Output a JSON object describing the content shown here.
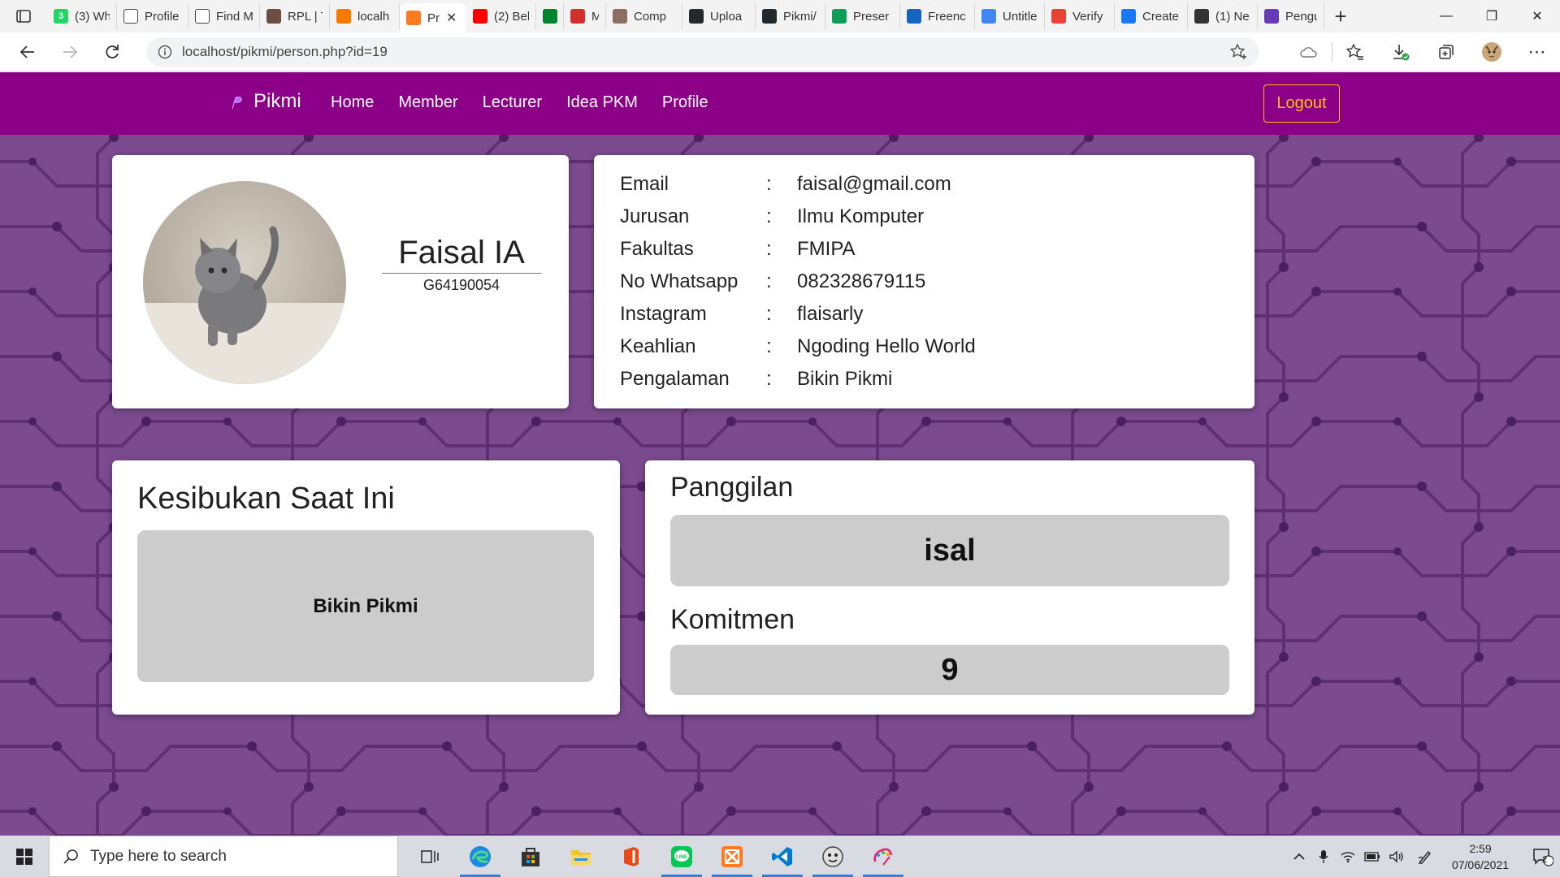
{
  "browser": {
    "tabs": [
      {
        "label": "(3) Wh",
        "icon": "whatsapp-icon",
        "color": "#25d366",
        "badge": "3"
      },
      {
        "label": "Profile",
        "icon": "page-icon",
        "color": "#ffffff"
      },
      {
        "label": "Find M",
        "icon": "page-icon",
        "color": "#ffffff"
      },
      {
        "label": "RPL | T",
        "icon": "book-icon",
        "color": "#6d4c41"
      },
      {
        "label": "localh",
        "icon": "phpmyadmin-icon",
        "color": "#f57c00"
      },
      {
        "label": "Pr",
        "icon": "xampp-icon",
        "color": "#fb7a24",
        "active": true
      },
      {
        "label": "(2) Bel",
        "icon": "youtube-icon",
        "color": "#ff0000"
      },
      {
        "label": "",
        "icon": "meet-icon",
        "color": "#00832d"
      },
      {
        "label": "M",
        "icon": "record-icon",
        "color": "#d32f2f"
      },
      {
        "label": "Comp",
        "icon": "cart-icon",
        "color": "#8d6e63"
      },
      {
        "label": "Uploa",
        "icon": "github-icon",
        "color": "#24292e"
      },
      {
        "label": "Pikmi/",
        "icon": "github-icon",
        "color": "#24292e"
      },
      {
        "label": "Preser",
        "icon": "plus-icon",
        "color": "#0f9d58"
      },
      {
        "label": "Freenc",
        "icon": "freenom-icon",
        "color": "#1565c0"
      },
      {
        "label": "Untitle",
        "icon": "docs-icon",
        "color": "#4285f4"
      },
      {
        "label": "Verify",
        "icon": "gmail-icon",
        "color": "#ea4335"
      },
      {
        "label": "Create",
        "icon": "infinity-icon",
        "color": "#1877f2"
      },
      {
        "label": "(1) Ne",
        "icon": "news-icon",
        "color": "#333333"
      },
      {
        "label": "Pengu",
        "icon": "form-icon",
        "color": "#673ab7"
      }
    ],
    "url": "localhost/pikmi/person.php?id=19"
  },
  "site": {
    "brand": "Pikmi",
    "nav": [
      "Home",
      "Member",
      "Lecturer",
      "Idea PKM",
      "Profile"
    ],
    "logout": "Logout",
    "colors": {
      "nav_bg": "#8b0087",
      "logout": "#ffc107",
      "page_bg": "#7b4a8f"
    }
  },
  "profile": {
    "name": "Faisal IA",
    "id": "G64190054",
    "avatar": "kitten-photo",
    "info": [
      {
        "key": "Email",
        "value": "faisal@gmail.com"
      },
      {
        "key": "Jurusan",
        "value": "Ilmu Komputer"
      },
      {
        "key": "Fakultas",
        "value": "FMIPA"
      },
      {
        "key": "No Whatsapp",
        "value": "082328679115"
      },
      {
        "key": "Instagram",
        "value": "flaisarly"
      },
      {
        "key": "Keahlian",
        "value": "Ngoding Hello World"
      },
      {
        "key": "Pengalaman",
        "value": "Bikin Pikmi"
      }
    ],
    "separator": ":"
  },
  "busy": {
    "title": "Kesibukan Saat Ini",
    "value": "Bikin Pikmi"
  },
  "calling": {
    "title": "Panggilan",
    "value": "isal",
    "commit_title": "Komitmen",
    "commit_value": "9"
  },
  "taskbar": {
    "search_placeholder": "Type here to search",
    "apps": [
      "task-view-icon",
      "edge-icon",
      "store-icon",
      "file-explorer-icon",
      "office-icon",
      "line-icon",
      "xampp-icon",
      "vscode-icon",
      "app-icon",
      "paint-icon"
    ],
    "time": "2:59",
    "date": "07/06/2021",
    "notifications": "2"
  }
}
